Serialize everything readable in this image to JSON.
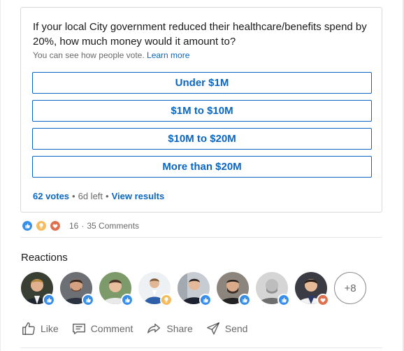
{
  "poll": {
    "question": "If your local City government reduced their healthcare/benefits spend by 20%, how much money would it amount to?",
    "vote_note": "You can see how people vote.",
    "learn_more": "Learn more",
    "options": [
      "Under $1M",
      "$1M to $10M",
      "$10M to $20M",
      "More than $20M"
    ],
    "votes": "62 votes",
    "time_left": "6d left",
    "view_results": "View results"
  },
  "social": {
    "reaction_icons": [
      "like-icon",
      "insightful-icon",
      "love-icon"
    ],
    "reaction_count": "16",
    "comments": "35 Comments"
  },
  "reactions": {
    "heading": "Reactions",
    "avatars": [
      {
        "badge": "like"
      },
      {
        "badge": "like"
      },
      {
        "badge": "like"
      },
      {
        "badge": "insightful"
      },
      {
        "badge": "like"
      },
      {
        "badge": "like"
      },
      {
        "badge": "like"
      },
      {
        "badge": "love"
      }
    ],
    "more": "+8"
  },
  "actions": {
    "like": "Like",
    "comment": "Comment",
    "share": "Share",
    "send": "Send"
  },
  "colors": {
    "accent": "#0a66c2",
    "like": "#378fe9",
    "insightful": "#f5bb5c",
    "love": "#df704d"
  }
}
